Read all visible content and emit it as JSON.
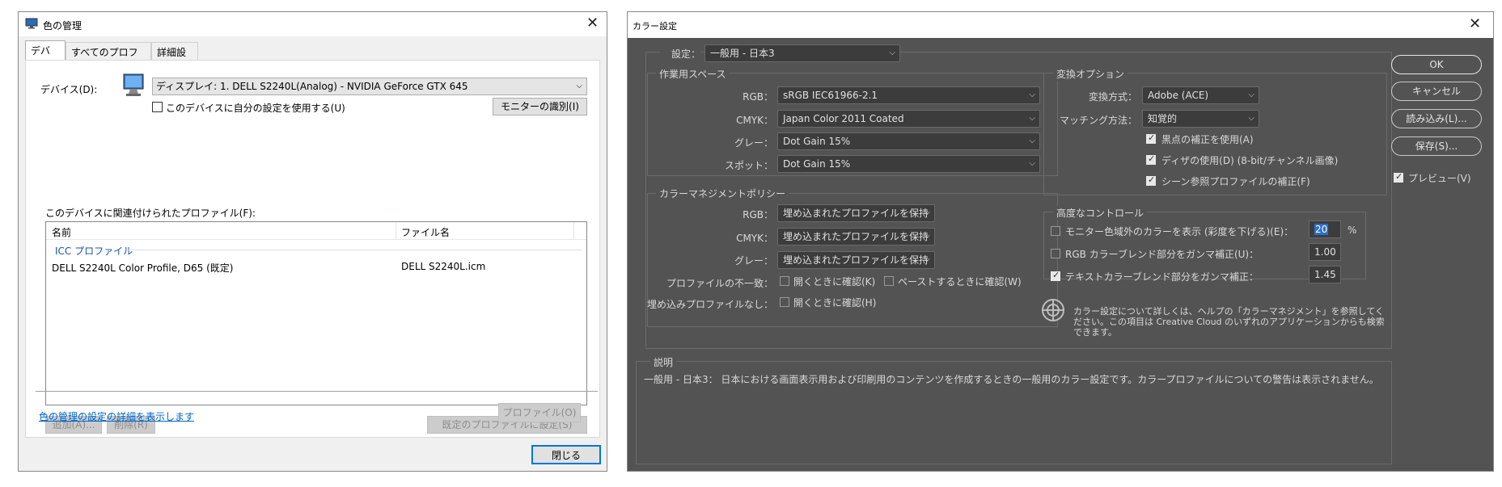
{
  "win1": {
    "title": "色の管理",
    "tabs": [
      "デバイス",
      "すべてのプロファイル",
      "詳細設定"
    ],
    "device_label": "デバイス(D):",
    "device_value": "ディスプレイ: 1. DELL S2240L(Analog) - NVIDIA GeForce GTX 645",
    "use_my_settings": "このデバイスに自分の設定を使用する(U)",
    "identify_monitor": "モニターの識別(I)",
    "assoc_profiles_label": "このデバイスに関連付けられたプロファイル(F):",
    "col_name": "名前",
    "col_filename": "ファイル名",
    "group_icc": "ICC プロファイル",
    "rows": [
      {
        "name": "DELL S2240L Color Profile, D65 (既定)",
        "file": "DELL S2240L.icm"
      }
    ],
    "add_btn": "追加(A)...",
    "remove_btn": "削除(R)",
    "set_default_btn": "既定のプロファイルに設定(S)",
    "link_advanced": "色の管理の設定の詳細を表示します",
    "profile_btn": "プロファイル(O)",
    "close_btn": "閉じる"
  },
  "win2": {
    "title": "カラー設定",
    "settings_label": "設定：",
    "settings_value": "一般用 - 日本3",
    "working_spaces": {
      "title": "作業用スペース",
      "rgb_label": "RGB：",
      "rgb_value": "sRGB IEC61966-2.1",
      "cmyk_label": "CMYK：",
      "cmyk_value": "Japan Color 2011 Coated",
      "gray_label": "グレー：",
      "gray_value": "Dot Gain 15%",
      "spot_label": "スポット：",
      "spot_value": "Dot Gain 15%"
    },
    "policies": {
      "title": "カラーマネジメントポリシー",
      "rgb_label": "RGB：",
      "rgb_value": "埋め込まれたプロファイルを保持",
      "cmyk_label": "CMYK：",
      "cmyk_value": "埋め込まれたプロファイルを保持",
      "gray_label": "グレー：",
      "gray_value": "埋め込まれたプロファイルを保持",
      "mismatch_label": "プロファイルの不一致：",
      "ask_open": "開くときに確認(K)",
      "ask_paste": "ペーストするときに確認(W)",
      "missing_label": "埋め込みプロファイルなし：",
      "ask_open2": "開くときに確認(H)"
    },
    "conversion": {
      "title": "変換オプション",
      "engine_label": "変換方式：",
      "engine_value": "Adobe (ACE)",
      "intent_label": "マッチング方法：",
      "intent_value": "知覚的",
      "bpc": "黒点の補正を使用(A)",
      "dither": "ディザの使用(D) (8-bit/チャンネル画像)",
      "scene": "シーン参照プロファイルの補正(F)"
    },
    "advanced": {
      "title": "高度なコントロール",
      "desaturate": "モニター色域外のカラーを表示 (彩度を下げる)(E)：",
      "desaturate_value": "20",
      "percent": "%",
      "blend_rgb": "RGB カラーブレンド部分をガンマ補正(U)：",
      "blend_rgb_value": "1.00",
      "blend_text": "テキストカラーブレンド部分をガンマ補正：",
      "blend_text_value": "1.45"
    },
    "info_text": "カラー設定について詳しくは、ヘルプの「カラーマネジメント」を参照してください。この項目は Creative Cloud のいずれのアプリケーションからも検索できます。",
    "description": {
      "title": "説明",
      "text": "一般用 - 日本3： 日本における画面表示用および印刷用のコンテンツを作成するときの一般用のカラー設定です。カラープロファイルについての警告は表示されません。"
    },
    "buttons": {
      "ok": "OK",
      "cancel": "キャンセル",
      "load": "読み込み(L)...",
      "save": "保存(S)...",
      "preview": "プレビュー(V)"
    }
  }
}
